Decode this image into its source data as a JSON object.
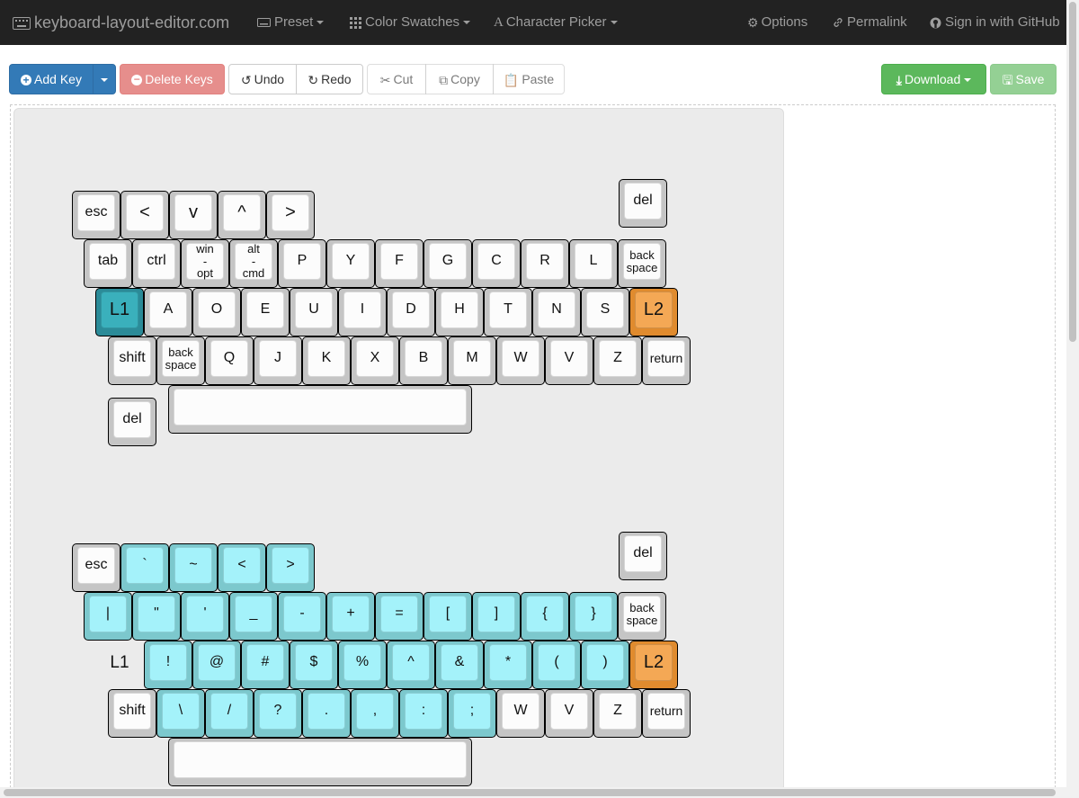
{
  "navbar": {
    "brand": "keyboard-layout-editor.com",
    "menus": [
      {
        "label": "Preset",
        "icon": "keyboard-icon"
      },
      {
        "label": "Color Swatches",
        "icon": "grid-icon"
      },
      {
        "label": "Character Picker",
        "icon": "font-icon"
      }
    ],
    "right": [
      {
        "label": "Options",
        "icon": "gear-icon"
      },
      {
        "label": "Permalink",
        "icon": "link-icon"
      },
      {
        "label": "Sign in with GitHub",
        "icon": "github-icon"
      }
    ]
  },
  "toolbar": {
    "add_key": "Add Key",
    "delete_keys": "Delete Keys",
    "undo": "Undo",
    "redo": "Redo",
    "cut": "Cut",
    "copy": "Copy",
    "paste": "Paste",
    "download": "Download",
    "save": "Save"
  },
  "colors": {
    "default_cap": "#fcfcfc",
    "symbol_cap": "#a4f2fa",
    "layer1_cap": "#3ab0bc",
    "layer2_cap": "#f4a855"
  },
  "layouts": [
    {
      "name": "base",
      "rows": [
        [
          "esc",
          "<",
          "v",
          "^",
          ">",
          "del"
        ],
        [
          "tab",
          "ctrl",
          "win\n-\nopt",
          "alt\n-\ncmd",
          "P",
          "Y",
          "F",
          "G",
          "C",
          "R",
          "L",
          "back\nspace"
        ],
        [
          "L1",
          "A",
          "O",
          "E",
          "U",
          "I",
          "D",
          "H",
          "T",
          "N",
          "S",
          "L2"
        ],
        [
          "shift",
          "back\nspace",
          "Q",
          "J",
          "K",
          "X",
          "B",
          "M",
          "W",
          "V",
          "Z",
          "return"
        ],
        [
          "del",
          ""
        ]
      ]
    },
    {
      "name": "layer1",
      "rows": [
        [
          "esc",
          "`",
          "~",
          "<",
          ">",
          "del"
        ],
        [
          "|",
          "\"",
          "'",
          "_",
          "-",
          "+",
          "=",
          "[",
          "]",
          "{",
          "}",
          "back\nspace"
        ],
        [
          "L1",
          "!",
          "@",
          "#",
          "$",
          "%",
          "^",
          "&",
          "*",
          "(",
          ")",
          "L2"
        ],
        [
          "shift",
          "\\",
          "/",
          "?",
          ".",
          ",",
          ":",
          ";",
          "W",
          "V",
          "Z",
          "return"
        ],
        [
          ""
        ]
      ]
    }
  ]
}
